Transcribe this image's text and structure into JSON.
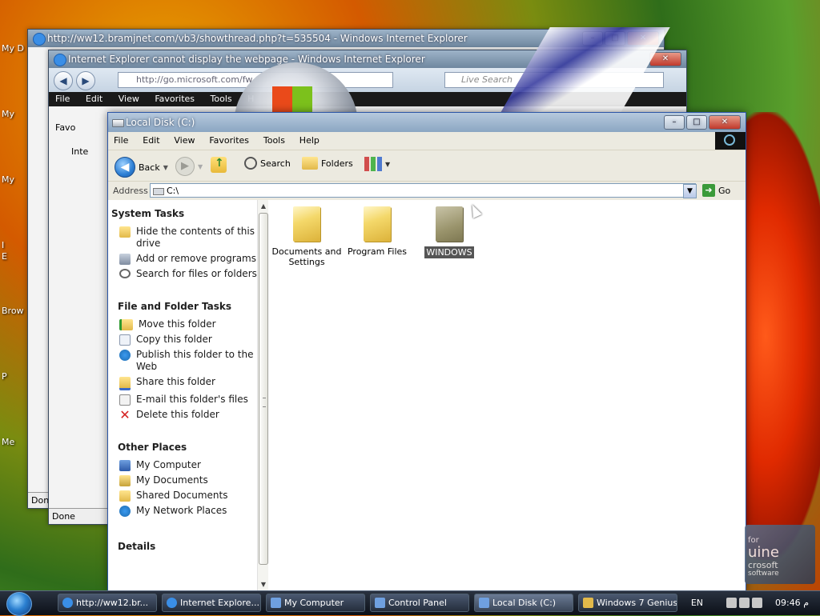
{
  "desktop": {
    "labels": [
      "My D",
      "My",
      "My",
      "I",
      "E",
      "Brow",
      "P",
      "Me"
    ]
  },
  "ie_back": {
    "title": "http://ww12.bramjnet.com/vb3/showthread.php?t=535504 - Windows Internet Explorer",
    "status": "Done"
  },
  "ie_front": {
    "title": "Internet Explorer cannot display the webpage - Windows Internet Explorer",
    "address": "http://go.microsoft.com/fw",
    "search_placeholder": "Live Search",
    "menu": [
      "File",
      "Edit",
      "View",
      "Favorites",
      "Tools",
      "H"
    ],
    "fav_label": "Favo",
    "tab_label": "Inte",
    "status": "Done"
  },
  "explorer": {
    "title": "Local Disk (C:)",
    "menu": [
      "File",
      "Edit",
      "View",
      "Favorites",
      "Tools",
      "Help"
    ],
    "toolbar": {
      "back": "Back",
      "search": "Search",
      "folders": "Folders"
    },
    "address": {
      "label": "Address",
      "value": "C:\\",
      "go": "Go"
    },
    "system_tasks": {
      "title": "System Tasks",
      "items": [
        {
          "label": "Hide the contents of this drive",
          "icon": "folder-hide-icon"
        },
        {
          "label": "Add or remove programs",
          "icon": "add-remove-programs-icon"
        },
        {
          "label": "Search for files or folders",
          "icon": "search-icon"
        }
      ]
    },
    "file_tasks": {
      "title": "File and Folder Tasks",
      "items": [
        {
          "label": "Move this folder",
          "icon": "move-folder-icon"
        },
        {
          "label": "Copy this folder",
          "icon": "copy-folder-icon"
        },
        {
          "label": "Publish this folder to the Web",
          "icon": "publish-web-icon"
        },
        {
          "label": "Share this folder",
          "icon": "share-folder-icon"
        },
        {
          "label": "E-mail this folder's files",
          "icon": "email-icon"
        },
        {
          "label": "Delete this folder",
          "icon": "delete-icon"
        }
      ]
    },
    "other_places": {
      "title": "Other Places",
      "items": [
        {
          "label": "My Computer",
          "icon": "my-computer-icon"
        },
        {
          "label": "My Documents",
          "icon": "my-documents-icon"
        },
        {
          "label": "Shared Documents",
          "icon": "shared-documents-icon"
        },
        {
          "label": "My Network Places",
          "icon": "network-places-icon"
        }
      ]
    },
    "details_title": "Details",
    "files": [
      {
        "name": "Documents and Settings",
        "type": "folder",
        "selected": false
      },
      {
        "name": "Program Files",
        "type": "folder",
        "selected": false
      },
      {
        "name": "WINDOWS",
        "type": "system-folder",
        "selected": true
      }
    ]
  },
  "genuine": {
    "line1": "for",
    "line2": "uine",
    "line3": "crosoft",
    "line4": "software"
  },
  "taskbar": {
    "buttons": [
      {
        "label": "http://ww12.br...",
        "icon": "ie-icon"
      },
      {
        "label": "Internet Explore...",
        "icon": "ie-icon"
      },
      {
        "label": "My Computer",
        "icon": "my-computer-icon"
      },
      {
        "label": "Control Panel",
        "icon": "control-panel-icon"
      },
      {
        "label": "Local Disk (C:)",
        "icon": "drive-icon"
      },
      {
        "label": "Windows 7 Genius",
        "icon": "folder-icon"
      }
    ],
    "language": "EN",
    "clock": "09:46 م"
  }
}
